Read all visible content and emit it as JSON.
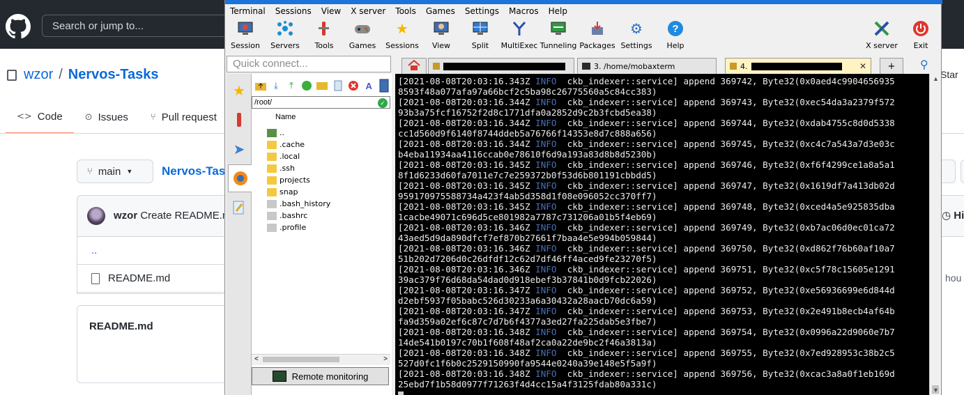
{
  "github": {
    "search_placeholder": "Search or jump to...",
    "owner": "wzor",
    "separator": "/",
    "repo": "Nervos-Tasks",
    "tabs": [
      {
        "icon": "<>",
        "label": "Code"
      },
      {
        "icon": "⊙",
        "label": "Issues"
      },
      {
        "icon": "⑂",
        "label": "Pull request"
      }
    ],
    "branch": "main",
    "crumb": "Nervos-Task",
    "commit_author": "wzor",
    "commit_message": "Create README.m",
    "files": [
      "..",
      "README.md"
    ],
    "readme_title": "README.md",
    "right_star": "Star",
    "right_history": "Hi",
    "right_hours": "hou"
  },
  "moba": {
    "menu": [
      "Terminal",
      "Sessions",
      "View",
      "X server",
      "Tools",
      "Games",
      "Settings",
      "Macros",
      "Help"
    ],
    "tools": [
      {
        "label": "Session",
        "icon": "session-icon"
      },
      {
        "label": "Servers",
        "icon": "servers-icon"
      },
      {
        "label": "Tools",
        "icon": "tools-icon"
      },
      {
        "label": "Games",
        "icon": "games-icon"
      },
      {
        "label": "Sessions",
        "icon": "sessions-icon"
      },
      {
        "label": "View",
        "icon": "view-icon"
      },
      {
        "label": "Split",
        "icon": "split-icon"
      },
      {
        "label": "MultiExec",
        "icon": "multiexec-icon"
      },
      {
        "label": "Tunneling",
        "icon": "tunneling-icon"
      },
      {
        "label": "Packages",
        "icon": "packages-icon"
      },
      {
        "label": "Settings",
        "icon": "settings-icon"
      },
      {
        "label": "Help",
        "icon": "help-icon"
      },
      {
        "label": "X server",
        "icon": "xserver-icon"
      },
      {
        "label": "Exit",
        "icon": "exit-icon"
      }
    ],
    "quick_connect_placeholder": "Quick connect...",
    "tabs": [
      {
        "label": "3. /home/mobaxterm"
      },
      {
        "label": "4."
      }
    ],
    "file_path": "/root/",
    "name_header": "Name",
    "files": [
      {
        "name": "..",
        "type": "up"
      },
      {
        "name": ".cache",
        "type": "folder"
      },
      {
        "name": ".local",
        "type": "folder"
      },
      {
        "name": ".ssh",
        "type": "folder"
      },
      {
        "name": "projects",
        "type": "folder"
      },
      {
        "name": "snap",
        "type": "folder"
      },
      {
        "name": ".bash_history",
        "type": "file"
      },
      {
        "name": ".bashrc",
        "type": "file"
      },
      {
        "name": ".profile",
        "type": "file"
      }
    ],
    "remote_monitoring": "Remote monitoring",
    "terminal_lines": [
      {
        "ts": "[2021-08-08T20:03:16.343Z",
        "lvl": "INFO",
        "rest": "  ckb_indexer::service] append 369742, Byte32(0x0aed4c9904656935",
        "cont": "8593f48a077afa97a66bcf2c5ba98c26775560a5c84cc383)"
      },
      {
        "ts": "[2021-08-08T20:03:16.344Z",
        "lvl": "INFO",
        "rest": "  ckb_indexer::service] append 369743, Byte32(0xec54da3a2379f572",
        "cont": "93b3a75fcf16752f2d8c1771dfa0a2852d9c2b3fcbd5ea38)"
      },
      {
        "ts": "[2021-08-08T20:03:16.344Z",
        "lvl": "INFO",
        "rest": "  ckb_indexer::service] append 369744, Byte32(0xdab4755c8d0d5338",
        "cont": "cc1d560d9f6140f8744ddeb5a76766f14353e8d7c888a656)"
      },
      {
        "ts": "[2021-08-08T20:03:16.344Z",
        "lvl": "INFO",
        "rest": "  ckb_indexer::service] append 369745, Byte32(0xc4c7a543a7d3e03c",
        "cont": "b4eba11934aa4116ccab0e78610f6d9a193a83d8b8d5230b)"
      },
      {
        "ts": "[2021-08-08T20:03:16.345Z",
        "lvl": "INFO",
        "rest": "  ckb_indexer::service] append 369746, Byte32(0xf6f4299ce1a8a5a1",
        "cont": "8f1d6233d60fa7011e7c7e259372b0f53d6b801191cbbdd5)"
      },
      {
        "ts": "[2021-08-08T20:03:16.345Z",
        "lvl": "INFO",
        "rest": "  ckb_indexer::service] append 369747, Byte32(0x1619df7a413db02d",
        "cont": "959170975588734a423f4ab5d358d1f08e096052cc370ff7)"
      },
      {
        "ts": "[2021-08-08T20:03:16.345Z",
        "lvl": "INFO",
        "rest": "  ckb_indexer::service] append 369748, Byte32(0xced4a5e925835dba",
        "cont": "1cacbe49071c696d5ce801982a7787c731206a01b5f4eb69)"
      },
      {
        "ts": "[2021-08-08T20:03:16.346Z",
        "lvl": "INFO",
        "rest": "  ckb_indexer::service] append 369749, Byte32(0xb7ac06d0ec01ca72",
        "cont": "43aed5d9da890dfcf7ef870b27661f7baa4e5e994b059844)"
      },
      {
        "ts": "[2021-08-08T20:03:16.346Z",
        "lvl": "INFO",
        "rest": "  ckb_indexer::service] append 369750, Byte32(0xd862f76b60af10a7",
        "cont": "51b202d7206d0c26dfdf12c62d7df46ff4aced9fe23270f5)"
      },
      {
        "ts": "[2021-08-08T20:03:16.346Z",
        "lvl": "INFO",
        "rest": "  ckb_indexer::service] append 369751, Byte32(0xc5f78c15605e1291",
        "cont": "39ac379f76d68da54dad0d918ebef3b37841b0d9fcb22026)"
      },
      {
        "ts": "[2021-08-08T20:03:16.347Z",
        "lvl": "INFO",
        "rest": "  ckb_indexer::service] append 369752, Byte32(0xe56936699e6d844d",
        "cont": "d2ebf5937f05babc526d30233a6a30432a28aacb70dc6a59)"
      },
      {
        "ts": "[2021-08-08T20:03:16.347Z",
        "lvl": "INFO",
        "rest": "  ckb_indexer::service] append 369753, Byte32(0x2e491b8ecb4af64b",
        "cont": "fa9d359a02ef6c87c7d7b6f4377a3ed27fa225dab5e3fbe7)"
      },
      {
        "ts": "[2021-08-08T20:03:16.348Z",
        "lvl": "INFO",
        "rest": "  ckb_indexer::service] append 369754, Byte32(0x0996a22d9060e7b7",
        "cont": "14de541b0197c70b1f608f48af2ca0a22de9bc2f46a3813a)"
      },
      {
        "ts": "[2021-08-08T20:03:16.348Z",
        "lvl": "INFO",
        "rest": "  ckb_indexer::service] append 369755, Byte32(0x7ed928953c38b2c5",
        "cont": "527d0fc1f6b0c2529150990fa9544e0240a39e148e5f5a9f)"
      },
      {
        "ts": "[2021-08-08T20:03:16.348Z",
        "lvl": "INFO",
        "rest": "  ckb_indexer::service] append 369756, Byte32(0xcac3a8a0f1eb169d",
        "cont": "25ebd7f1b58d0977f71263f4d4cc15a4f3125fdab80a331c)"
      }
    ]
  },
  "colors": {
    "github_header": "#24292f",
    "github_link": "#0969da",
    "moba_accent": "#1a74d9",
    "terminal_bg": "#000000",
    "terminal_info": "#4a6fb3"
  }
}
